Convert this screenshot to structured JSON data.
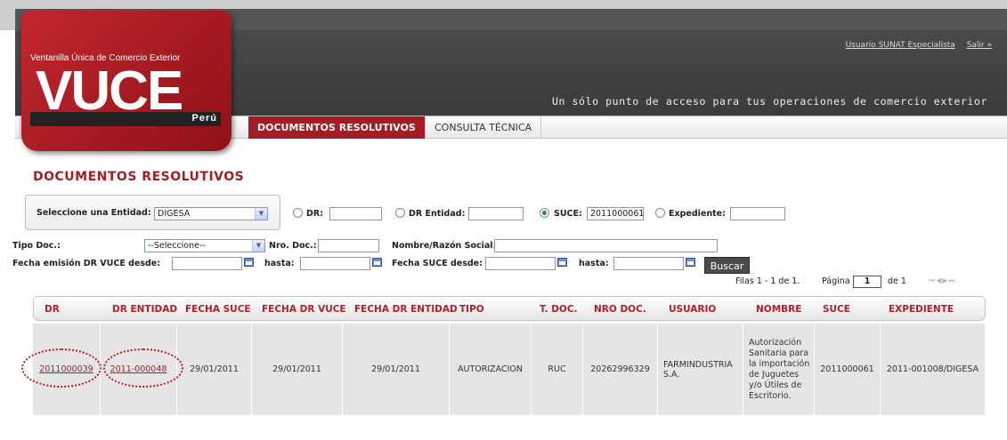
{
  "header": {
    "user_link": "Usuario SUNAT Especialista",
    "logout_link": "Salir »",
    "tagline": "Un sólo punto de acceso para tus operaciones de comercio exterior"
  },
  "logo": {
    "subtitle": "Ventanilla Única de Comercio Exterior",
    "name": "VUCE",
    "country": "Perú",
    "color": "#a51d24"
  },
  "nav": {
    "tabs": [
      {
        "label": "DOCUMENTOS RESOLUTIVOS",
        "active": true
      },
      {
        "label": "CONSULTA TÉCNICA",
        "active": false
      }
    ]
  },
  "page_title": "DOCUMENTOS RESOLUTIVOS",
  "filters": {
    "entity_label": "Seleccione una Entidad:",
    "entity_value": "DIGESA",
    "dr_label": "DR:",
    "dr_value": "",
    "dr_entidad_label": "DR Entidad:",
    "dr_entidad_value": "",
    "suce_label": "SUCE:",
    "suce_value": "2011000061",
    "expediente_label": "Expediente:",
    "expediente_value": "",
    "selected_radio": "SUCE",
    "tipo_doc_label": "Tipo Doc.:",
    "tipo_doc_value": "--Seleccione--",
    "nro_doc_label": "Nro. Doc.:",
    "nro_doc_value": "",
    "nombre_label": "Nombre/Razón Social:",
    "nombre_value": "",
    "fecha_emision_label": "Fecha emisión DR VUCE desde:",
    "hasta_label_1": "hasta:",
    "fecha_suce_label": "Fecha SUCE desde:",
    "hasta_label_2": "hasta:",
    "search_button": "Buscar"
  },
  "pager": {
    "rows_text": "Filas 1 - 1 de 1.",
    "page_label": "Página",
    "page_value": "1",
    "of_text": "de 1"
  },
  "table": {
    "columns": [
      "DR",
      "DR ENTIDAD",
      "FECHA SUCE",
      "FECHA DR VUCE",
      "FECHA DR ENTIDAD",
      "TIPO",
      "T. DOC.",
      "NRO DOC.",
      "USUARIO",
      "NOMBRE",
      "SUCE",
      "EXPEDIENTE"
    ],
    "rows": [
      {
        "dr": "2011000039",
        "dr_entidad": "2011-000048",
        "fecha_suce": "29/01/2011",
        "fecha_dr_vuce": "29/01/2011",
        "fecha_dr_entidad": "29/01/2011",
        "tipo": "AUTORIZACION",
        "t_doc": "RUC",
        "nro_doc": "20262996329",
        "usuario": "FARMINDUSTRIA S.A.",
        "nombre": "Autorización Sanitaria para la importación de Juguetes y/o Útiles de Escritorio.",
        "suce": "2011000061",
        "expediente": "2011-001008/DIGESA"
      }
    ]
  }
}
